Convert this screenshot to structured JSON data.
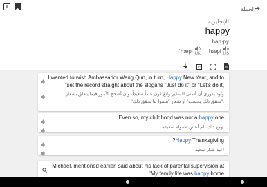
{
  "toolbar": {
    "back_label": "لجملة"
  },
  "entry": {
    "language": "الإنجليزية",
    "word": "happy",
    "syllables": "hap·py",
    "uk_ipa": "ˈhæpi",
    "uk_code": "UK",
    "us_ipa": "ˈhæpi",
    "us_code": "US"
  },
  "examples": [
    {
      "en_before": "I wanted to wish Ambassador Wang Qun, in turn, ",
      "en_hl": "Happy",
      "en_after": " New Year, and to",
      "en_line2": "\"set the record straight about the slogans \"Just do it\" or \"Let's do it,",
      "ar_line1": "وأود بدوري أن أتمنى للسفير وانغ كون عاماً سعيداً، وأن أصحح الأمور فيما يتعلق بشعار",
      "ar_line2": "\"تحقق ذلك بحسب\" أو شعار \"هلموا بنا نحقق ذلك\"."
    },
    {
      "en_before": ".Even so, my childhood was not a ",
      "en_hl": "happy",
      "en_after": " one",
      "ar_line1": "ومع ذلك، لم أعش طفولة سعيدة."
    },
    {
      "en_before": "?",
      "en_hl": "Happy",
      "en_after": " Thanksgiving",
      "ar_line1": "عيد شكر سعيد!"
    }
  ],
  "search_result": {
    "line1": "Michael, mentioned earlier, said about his lack of parental supervision at",
    "line2_before": "\"My family life was ",
    "line2_hl": "happy",
    "line2_after": ":home"
  }
}
